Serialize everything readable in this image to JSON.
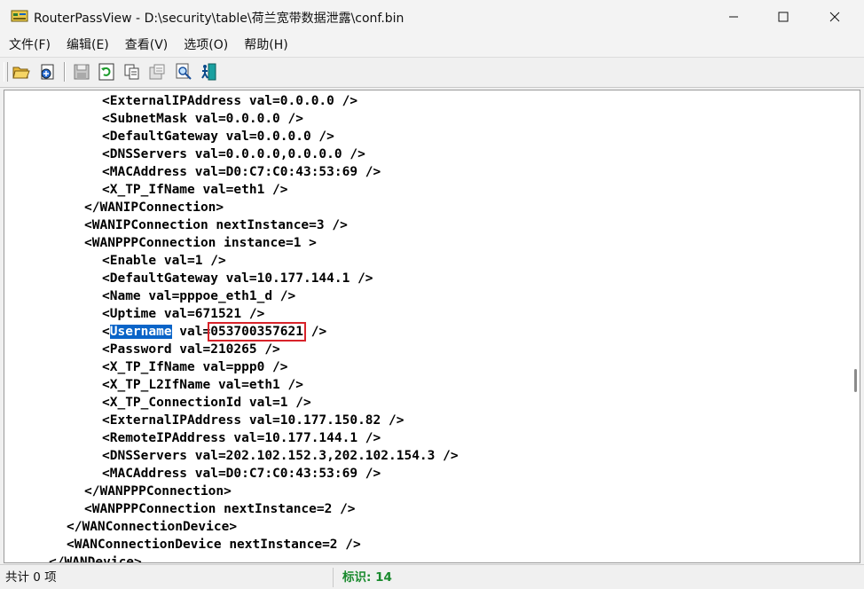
{
  "window": {
    "app_name": "RouterPassView",
    "title_separator": " - ",
    "file_path": "D:\\security\\table\\荷兰宽带数据泄露\\conf.bin",
    "minimize_icon": "minimize-icon",
    "maximize_icon": "maximize-icon",
    "close_icon": "close-icon"
  },
  "menu": [
    {
      "label": "文件(F)"
    },
    {
      "label": "编辑(E)"
    },
    {
      "label": "查看(V)"
    },
    {
      "label": "选项(O)"
    },
    {
      "label": "帮助(H)"
    }
  ],
  "toolbar": {
    "buttons": [
      {
        "icon": "open-folder-icon"
      },
      {
        "icon": "open-config-icon"
      },
      {
        "icon": "save-icon"
      },
      {
        "icon": "refresh-icon"
      },
      {
        "icon": "copy-icon"
      },
      {
        "icon": "properties-icon"
      },
      {
        "icon": "find-icon"
      },
      {
        "icon": "exit-icon"
      }
    ]
  },
  "content": {
    "lines": [
      {
        "indent": 10,
        "text": "<ExternalIPAddress val=0.0.0.0 />"
      },
      {
        "indent": 10,
        "text": "<SubnetMask val=0.0.0.0 />"
      },
      {
        "indent": 10,
        "text": "<DefaultGateway val=0.0.0.0 />"
      },
      {
        "indent": 10,
        "text": "<DNSServers val=0.0.0.0,0.0.0.0 />"
      },
      {
        "indent": 10,
        "text": "<MACAddress val=D0:C7:C0:43:53:69 />"
      },
      {
        "indent": 10,
        "text": "<X_TP_IfName val=eth1 />"
      },
      {
        "indent": 8,
        "text": "</WANIPConnection>"
      },
      {
        "indent": 8,
        "text": "<WANIPConnection nextInstance=3 />"
      },
      {
        "indent": 8,
        "text": "<WANPPPConnection instance=1 >"
      },
      {
        "indent": 10,
        "text": "<Enable val=1 />"
      },
      {
        "indent": 10,
        "text": "<DefaultGateway val=10.177.144.1 />"
      },
      {
        "indent": 10,
        "text": "<Name val=pppoe_eth1_d />"
      },
      {
        "indent": 10,
        "text": "<Uptime val=671521 />"
      },
      {
        "indent": 10,
        "special": "username"
      },
      {
        "indent": 10,
        "text": "<Password val=210265 />"
      },
      {
        "indent": 10,
        "text": "<X_TP_IfName val=ppp0 />"
      },
      {
        "indent": 10,
        "text": "<X_TP_L2IfName val=eth1 />"
      },
      {
        "indent": 10,
        "text": "<X_TP_ConnectionId val=1 />"
      },
      {
        "indent": 10,
        "text": "<ExternalIPAddress val=10.177.150.82 />"
      },
      {
        "indent": 10,
        "text": "<RemoteIPAddress val=10.177.144.1 />"
      },
      {
        "indent": 10,
        "text": "<DNSServers val=202.102.152.3,202.102.154.3 />"
      },
      {
        "indent": 10,
        "text": "<MACAddress val=D0:C7:C0:43:53:69 />"
      },
      {
        "indent": 8,
        "text": "</WANPPPConnection>"
      },
      {
        "indent": 8,
        "text": "<WANPPPConnection nextInstance=2 />"
      },
      {
        "indent": 6,
        "text": "</WANConnectionDevice>"
      },
      {
        "indent": 6,
        "text": "<WANConnectionDevice nextInstance=2 />"
      },
      {
        "indent": 4,
        "text": "</WANDevice>"
      }
    ],
    "username_line": {
      "open": "<",
      "tag": "Username",
      "attr": " val=",
      "value": "053700357621",
      "close": " />"
    }
  },
  "status": {
    "count": "共计 0 项",
    "mark": "标识: 14"
  }
}
